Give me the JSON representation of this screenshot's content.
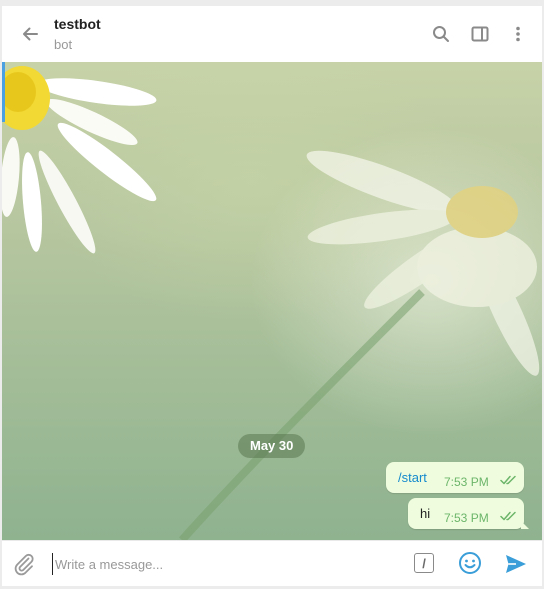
{
  "header": {
    "title": "testbot",
    "subtitle": "bot",
    "icons": [
      "back-arrow-icon",
      "search-icon",
      "sidebar-toggle-icon",
      "more-vertical-icon"
    ]
  },
  "chat": {
    "date_label": "May 30",
    "messages": [
      {
        "text": "/start",
        "time": "7:53 PM",
        "status": "read",
        "is_command": true
      },
      {
        "text": "hi",
        "time": "7:53 PM",
        "status": "read",
        "is_command": false
      }
    ]
  },
  "composer": {
    "placeholder": "Write a message...",
    "value": "",
    "command_label": "/",
    "icons": [
      "attach-paperclip-icon",
      "bot-command-icon",
      "emoji-smile-icon",
      "send-icon"
    ]
  },
  "colors": {
    "accent": "#4aa0e0",
    "bubble_out": "#effdde",
    "time_out": "#6cb56a",
    "link": "#168acd"
  }
}
